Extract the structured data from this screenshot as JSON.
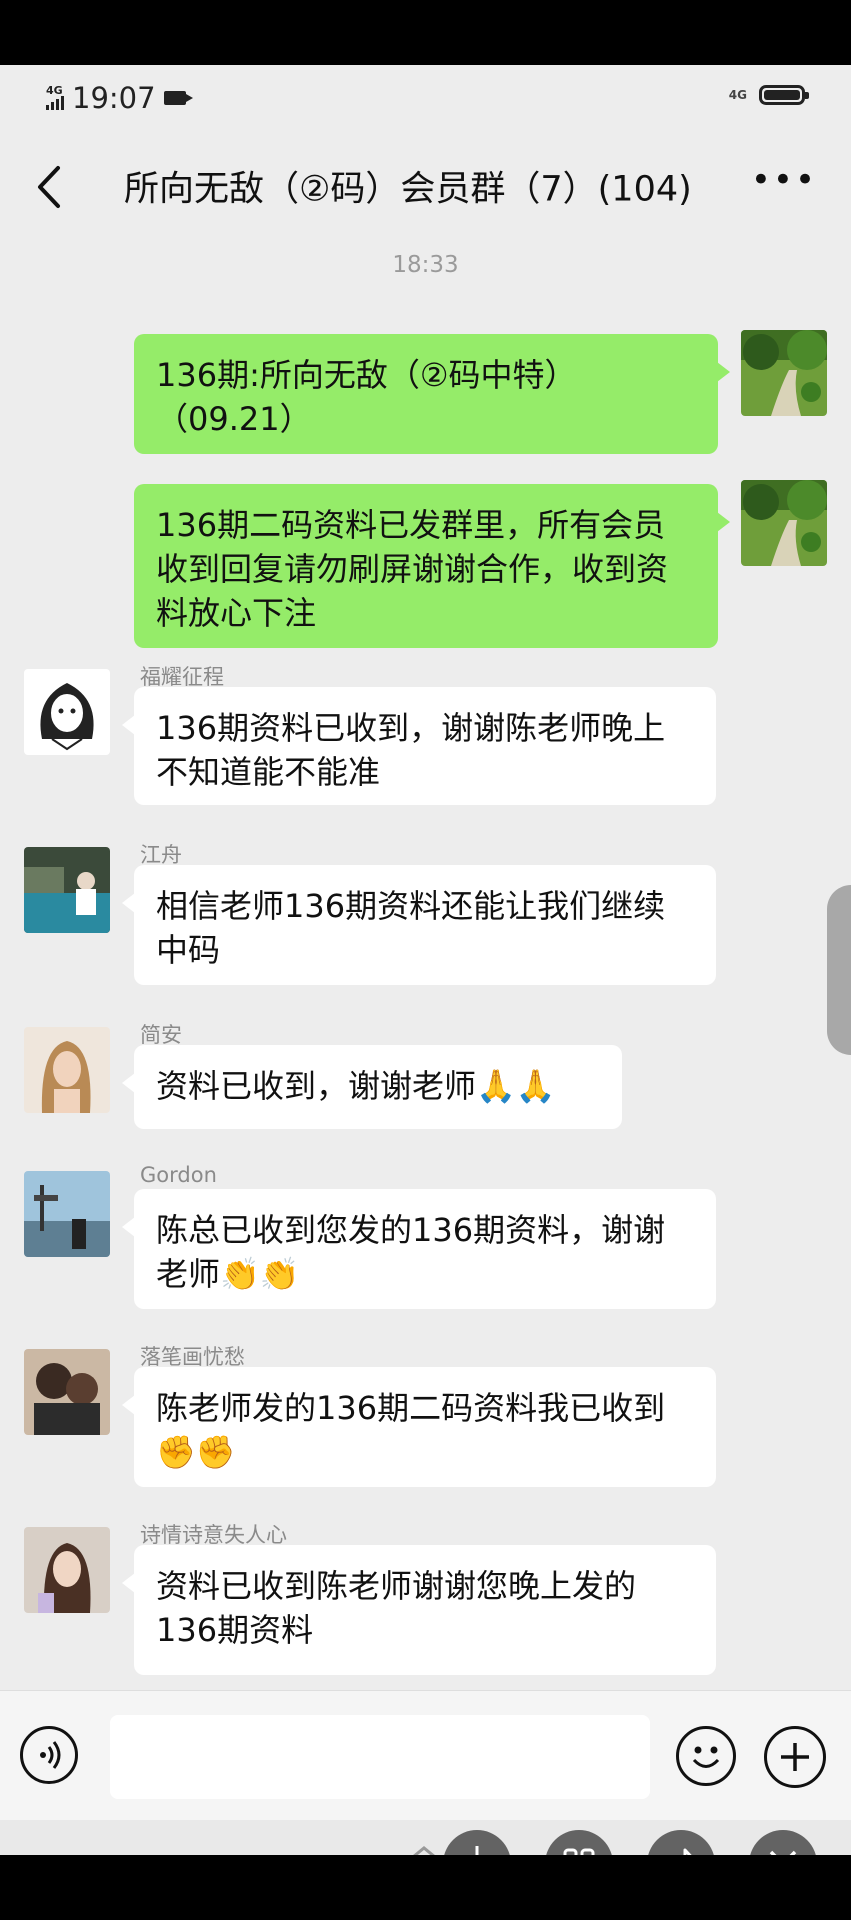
{
  "status_bar": {
    "network_left": "4G",
    "time": "19:07",
    "network_right": "4G"
  },
  "header": {
    "back_icon": "chevron-left-icon",
    "title": "所向无敌（②码）会员群（7）(104)",
    "more_label": "•••"
  },
  "chat": {
    "timestamp": "18:33",
    "outgoing": [
      {
        "text": "136期:所向无敌（②码中特）（09.21）"
      },
      {
        "text": "136期二码资料已发群里，所有会员收到回复请勿刷屏谢谢合作，收到资料放心下注"
      }
    ],
    "incoming": [
      {
        "sender": "福耀征程",
        "text": "136期资料已收到，谢谢陈老师晚上不知道能不能准"
      },
      {
        "sender": "江舟",
        "text": "相信老师136期资料还能让我们继续中码"
      },
      {
        "sender": "简安",
        "text": "资料已收到，谢谢老师",
        "emoji": "🙏🙏"
      },
      {
        "sender": "Gordon",
        "text": "陈总已收到您发的136期资料，谢谢老师",
        "emoji": "👏👏"
      },
      {
        "sender": "落笔画忧愁",
        "text": "陈老师发的136期二码资料我已收到",
        "emoji": "✊✊"
      },
      {
        "sender": "诗情诗意失人心",
        "text": "资料已收到陈老师谢谢您晚上发的136期资料"
      }
    ]
  },
  "input_bar": {
    "voice_icon": "voice-icon",
    "emoji_icon": "smiley-icon",
    "plus_icon": "plus-icon"
  },
  "colors": {
    "outgoing_bubble": "#95ec69",
    "incoming_bubble": "#ffffff",
    "chat_background": "#ededed"
  }
}
